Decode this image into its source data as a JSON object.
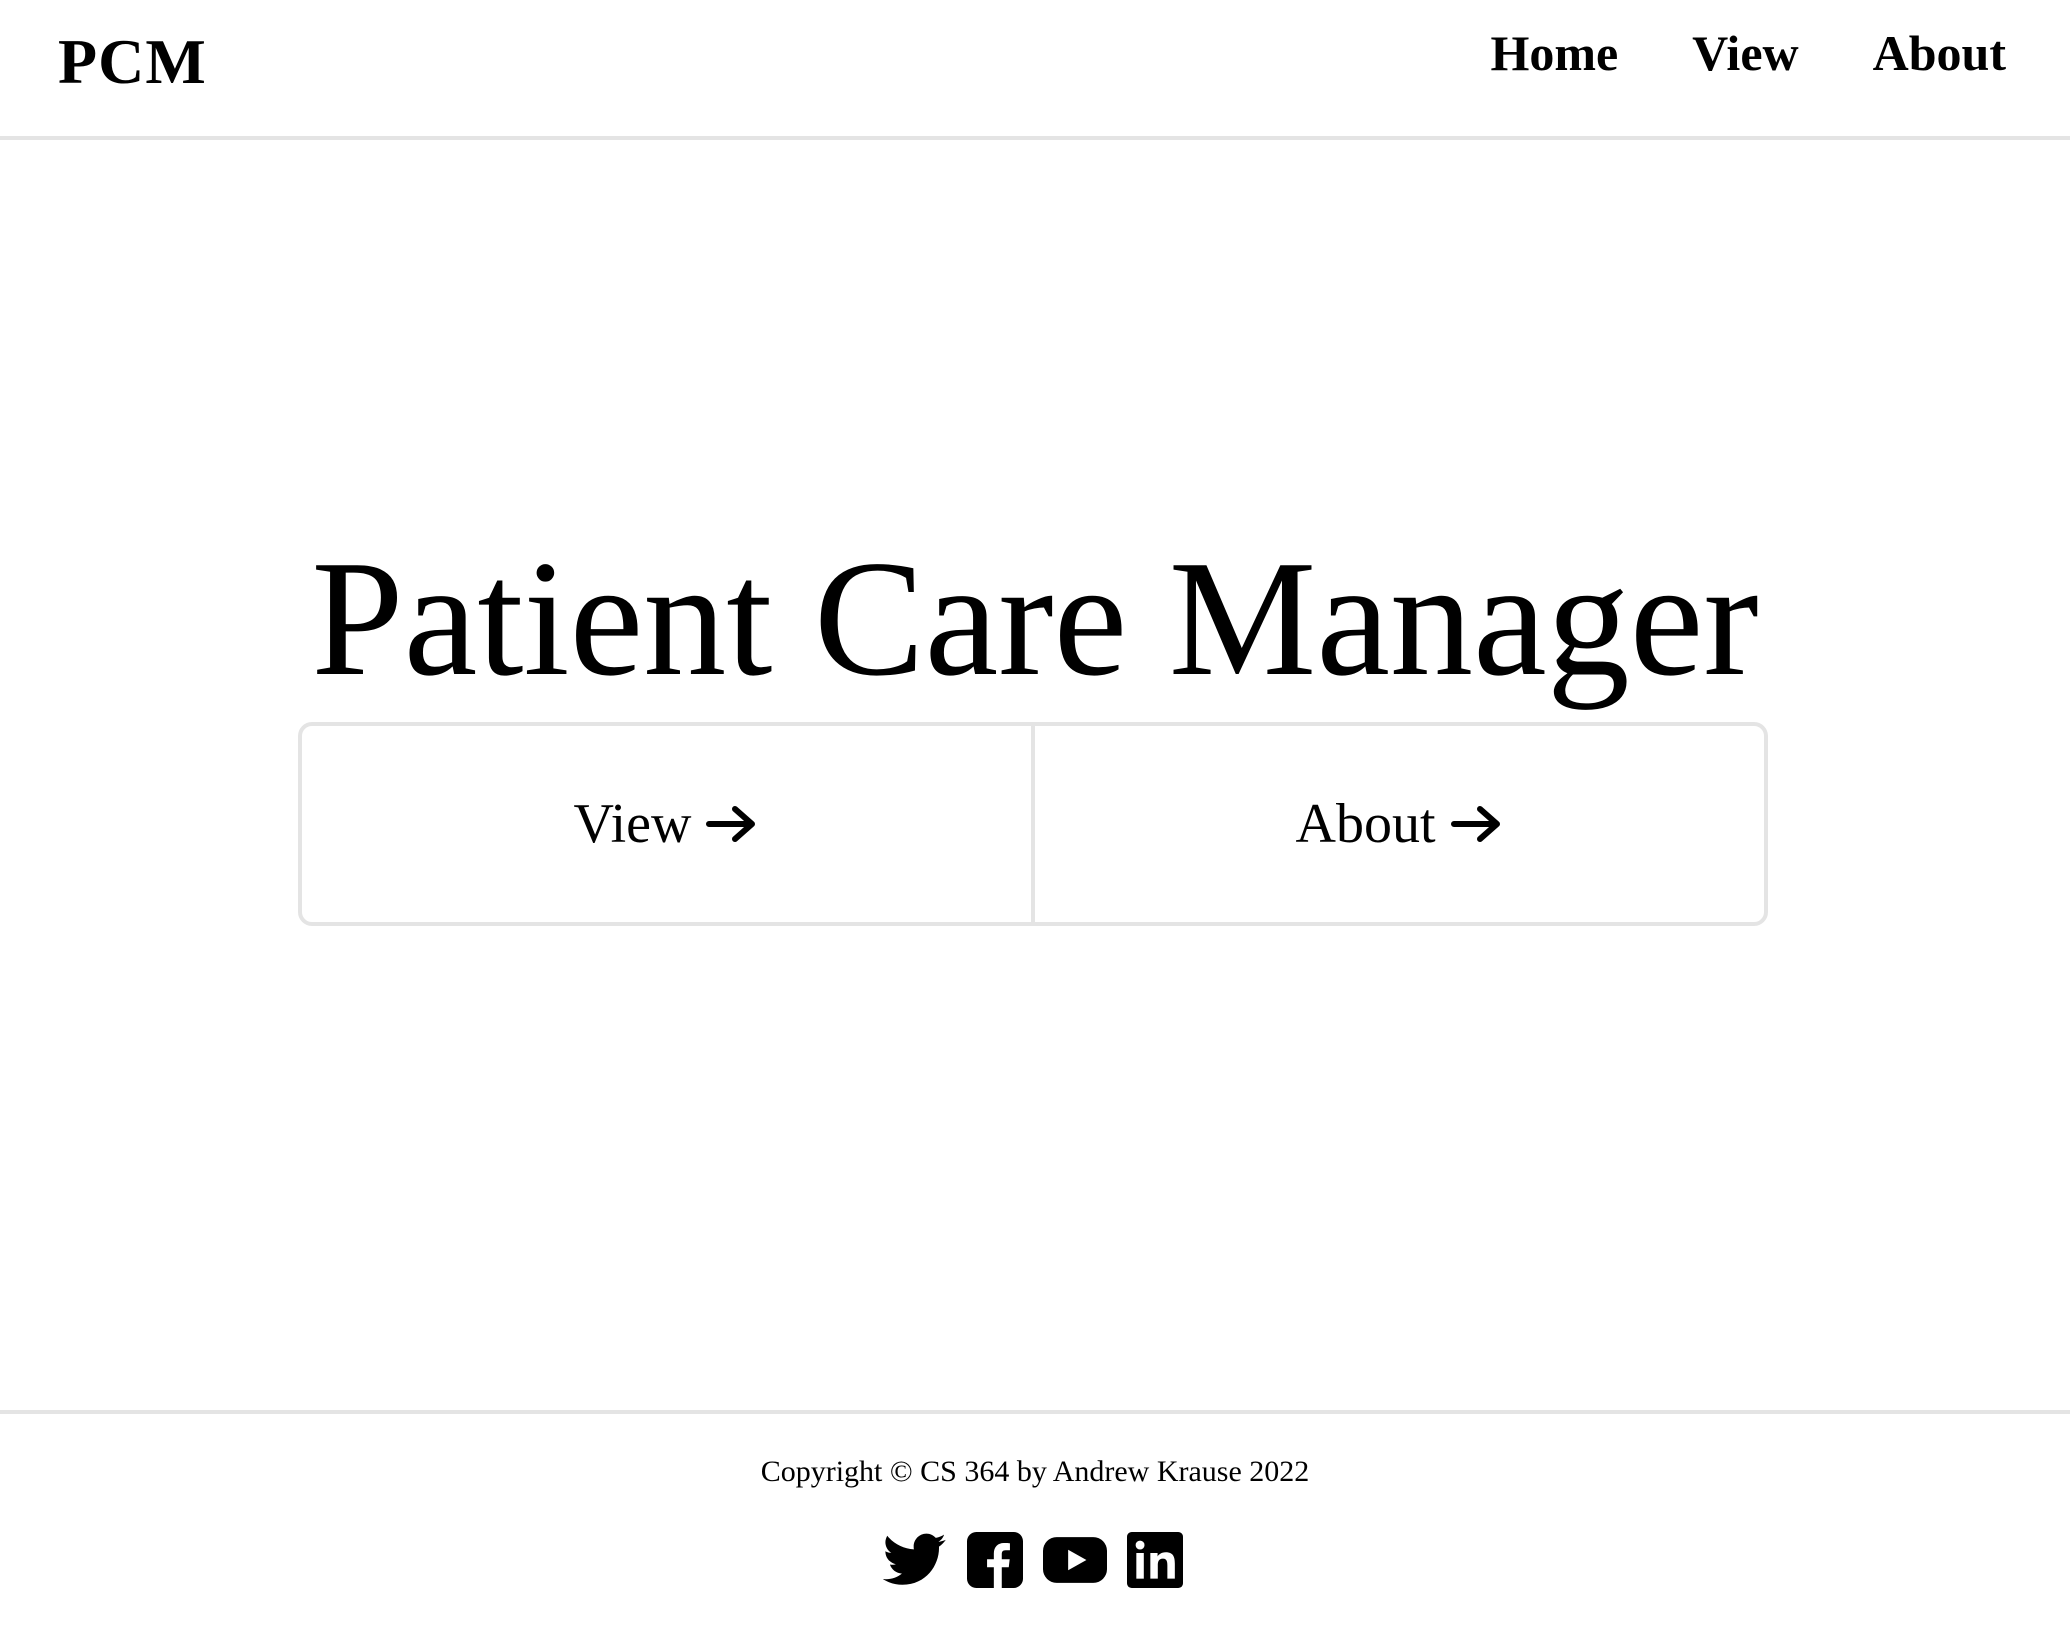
{
  "header": {
    "brand": "PCM",
    "nav": [
      {
        "label": "Home"
      },
      {
        "label": "View"
      },
      {
        "label": "About"
      }
    ]
  },
  "hero": {
    "title": "Patient Care Manager",
    "buttons": [
      {
        "label": "View",
        "icon": "arrow-right-icon"
      },
      {
        "label": "About",
        "icon": "arrow-right-icon"
      }
    ]
  },
  "footer": {
    "copyright": "Copyright © CS 364 by Andrew Krause 2022",
    "social": [
      "twitter-icon",
      "facebook-icon",
      "youtube-icon",
      "linkedin-icon"
    ]
  }
}
